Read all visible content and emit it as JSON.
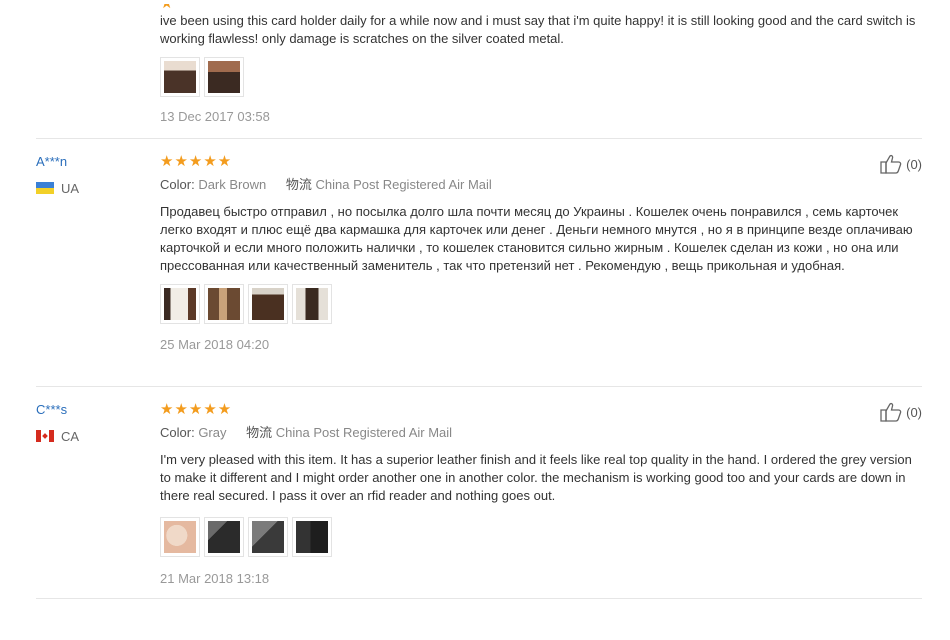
{
  "reviews": [
    {
      "text": "ive been using this card holder daily for a while now and i must say that i'm quite happy! it is still looking good and the card switch is working flawless! only damage is scratches on the silver coated metal.",
      "photos": [
        {
          "top": "#e9dcd0",
          "main": "#4a3328"
        },
        {
          "top": "#a06b4e",
          "main": "#3b2a22"
        }
      ],
      "date": "13 Dec 2017 03:58"
    },
    {
      "user": "A***n",
      "country": "UA",
      "stars": "★★★★★",
      "color_label": "Color:",
      "color_value": "Dark Brown",
      "shipping_label": "物流",
      "shipping_value": "China Post Registered Air Mail",
      "text": "Продавец быстро отправил , но посылка долго шла почти месяц до Украины . Кошелек очень понравился , семь карточек легко входят и плюс ещё два кармашка для карточек или денег . Деньги немного мнутся , но я в принципе везде оплачиваю карточкой и если много положить налички , то кошелек становится сильно жирным . Кошелек сделан из кожи , но она или прессованная или качественный заменитель , так что претензий нет . Рекомендую , вещь прикольная и удобная.",
      "photos": [
        {
          "top": "#3b2a22",
          "main": "#5c3a28"
        },
        {
          "top": "#c9a27a",
          "main": "#6b4a32"
        },
        {
          "top": "#d8d2c8",
          "main": "#4a3021"
        },
        {
          "top": "#e5e0d8",
          "main": "#3a2a20"
        }
      ],
      "date": "25 Mar 2018 04:20",
      "likes": "(0)"
    },
    {
      "user": "C***s",
      "country": "CA",
      "stars": "★★★★★",
      "color_label": "Color:",
      "color_value": "Gray",
      "shipping_label": "物流",
      "shipping_value": "China Post Registered Air Mail",
      "text": "I'm very pleased with this item. It has a superior leather finish and it feels like real top quality in the hand. I ordered the grey version to make it different and I might order another one in another color. the mechanism is working good too and your cards are down in there real secured. I pass it over an rfid reader and nothing goes out.",
      "photos": [
        {
          "top": "#f0d9c8",
          "main": "#e5b9a0"
        },
        {
          "top": "#6a6a6a",
          "main": "#2b2b2b"
        },
        {
          "top": "#7b7b7b",
          "main": "#3a3a3a"
        },
        {
          "top": "#333333",
          "main": "#1e1e1e"
        }
      ],
      "date": "21 Mar 2018 13:18",
      "likes": "(0)"
    }
  ]
}
